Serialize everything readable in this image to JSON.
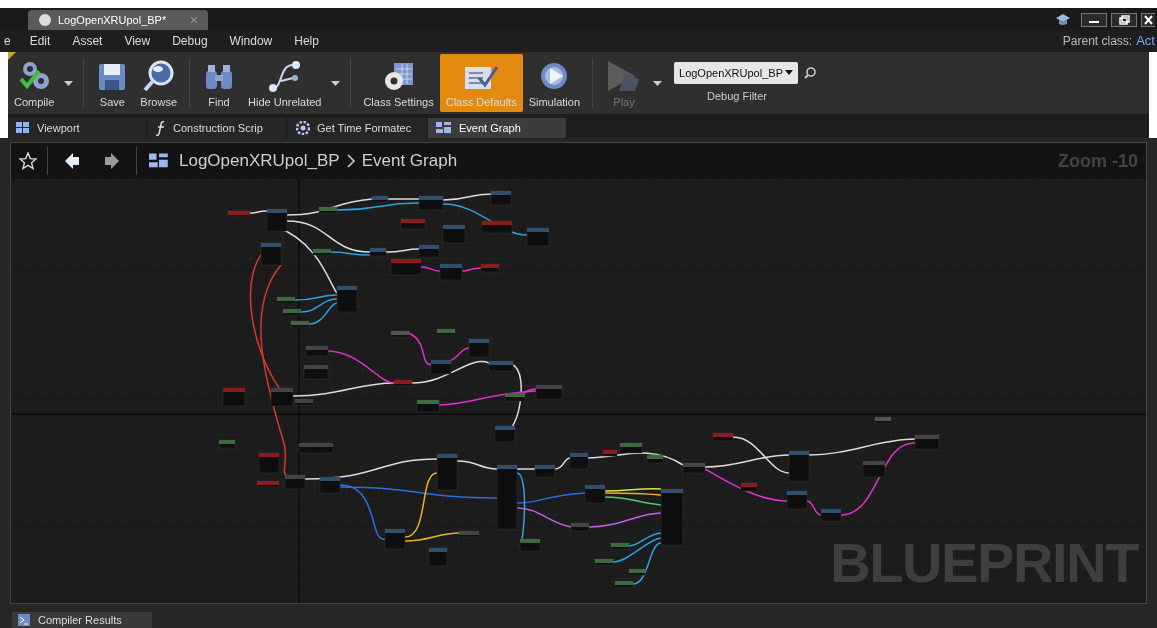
{
  "window": {
    "tab_title": "LogOpenXRUpol_BP*",
    "parent_class_label": "Parent class:",
    "parent_class": "Act"
  },
  "menu": [
    "e",
    "Edit",
    "Asset",
    "View",
    "Debug",
    "Window",
    "Help"
  ],
  "toolbar": [
    {
      "kind": "compile",
      "label": "Compile",
      "dropdown": true,
      "selected": false,
      "disabled": false
    },
    {
      "kind": "save",
      "label": "Save",
      "dropdown": false,
      "selected": false,
      "disabled": false
    },
    {
      "kind": "browse",
      "label": "Browse",
      "dropdown": false,
      "selected": false,
      "disabled": false
    },
    {
      "kind": "find",
      "label": "Find",
      "dropdown": false,
      "selected": false,
      "disabled": false
    },
    {
      "kind": "hide_unrelated",
      "label": "Hide Unrelated",
      "dropdown": true,
      "selected": false,
      "disabled": false
    },
    {
      "kind": "class_settings",
      "label": "Class Settings",
      "dropdown": false,
      "selected": false,
      "disabled": false
    },
    {
      "kind": "class_defaults",
      "label": "Class Defaults",
      "dropdown": false,
      "selected": true,
      "disabled": false
    },
    {
      "kind": "simulation",
      "label": "Simulation",
      "dropdown": false,
      "selected": false,
      "disabled": false
    },
    {
      "kind": "play",
      "label": "Play",
      "dropdown": true,
      "selected": false,
      "disabled": true
    }
  ],
  "debug_filter": {
    "value": "LogOpenXRUpol_BP",
    "label": "Debug Filter"
  },
  "doc_tabs": [
    {
      "kind": "viewport",
      "label": "Viewport",
      "selected": false
    },
    {
      "kind": "function",
      "label": "Construction Scrip",
      "selected": false
    },
    {
      "kind": "gear",
      "label": "Get Time Formatec",
      "selected": false
    },
    {
      "kind": "graph",
      "label": "Event Graph",
      "selected": true
    }
  ],
  "breadcrumb": [
    "LogOpenXRUpol_BP",
    "Event Graph"
  ],
  "graph": {
    "zoom": "Zoom -10",
    "watermark": "BLUEPRINT"
  },
  "bottom_tab": {
    "label": "Compiler Results"
  }
}
